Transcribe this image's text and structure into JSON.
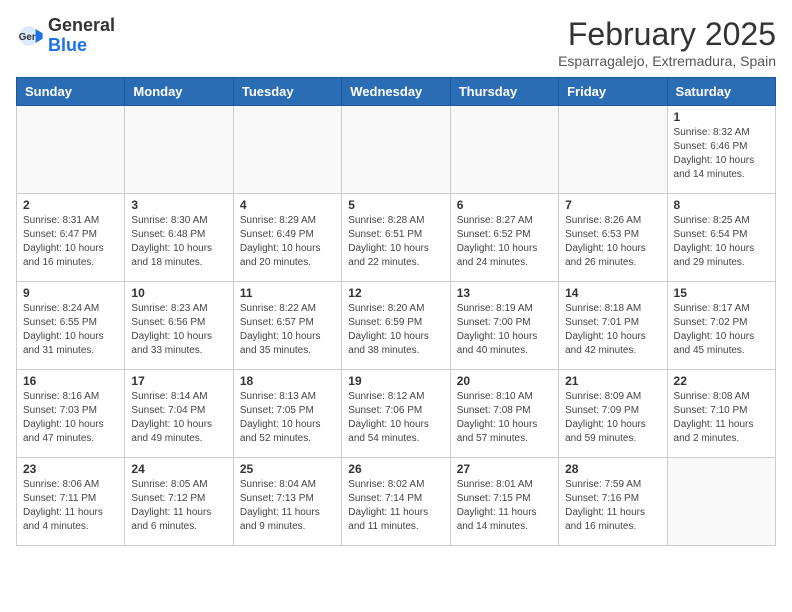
{
  "header": {
    "logo_general": "General",
    "logo_blue": "Blue",
    "month_year": "February 2025",
    "location": "Esparragalejo, Extremadura, Spain"
  },
  "weekdays": [
    "Sunday",
    "Monday",
    "Tuesday",
    "Wednesday",
    "Thursday",
    "Friday",
    "Saturday"
  ],
  "weeks": [
    [
      {
        "day": "",
        "info": ""
      },
      {
        "day": "",
        "info": ""
      },
      {
        "day": "",
        "info": ""
      },
      {
        "day": "",
        "info": ""
      },
      {
        "day": "",
        "info": ""
      },
      {
        "day": "",
        "info": ""
      },
      {
        "day": "1",
        "info": "Sunrise: 8:32 AM\nSunset: 6:46 PM\nDaylight: 10 hours and 14 minutes."
      }
    ],
    [
      {
        "day": "2",
        "info": "Sunrise: 8:31 AM\nSunset: 6:47 PM\nDaylight: 10 hours and 16 minutes."
      },
      {
        "day": "3",
        "info": "Sunrise: 8:30 AM\nSunset: 6:48 PM\nDaylight: 10 hours and 18 minutes."
      },
      {
        "day": "4",
        "info": "Sunrise: 8:29 AM\nSunset: 6:49 PM\nDaylight: 10 hours and 20 minutes."
      },
      {
        "day": "5",
        "info": "Sunrise: 8:28 AM\nSunset: 6:51 PM\nDaylight: 10 hours and 22 minutes."
      },
      {
        "day": "6",
        "info": "Sunrise: 8:27 AM\nSunset: 6:52 PM\nDaylight: 10 hours and 24 minutes."
      },
      {
        "day": "7",
        "info": "Sunrise: 8:26 AM\nSunset: 6:53 PM\nDaylight: 10 hours and 26 minutes."
      },
      {
        "day": "8",
        "info": "Sunrise: 8:25 AM\nSunset: 6:54 PM\nDaylight: 10 hours and 29 minutes."
      }
    ],
    [
      {
        "day": "9",
        "info": "Sunrise: 8:24 AM\nSunset: 6:55 PM\nDaylight: 10 hours and 31 minutes."
      },
      {
        "day": "10",
        "info": "Sunrise: 8:23 AM\nSunset: 6:56 PM\nDaylight: 10 hours and 33 minutes."
      },
      {
        "day": "11",
        "info": "Sunrise: 8:22 AM\nSunset: 6:57 PM\nDaylight: 10 hours and 35 minutes."
      },
      {
        "day": "12",
        "info": "Sunrise: 8:20 AM\nSunset: 6:59 PM\nDaylight: 10 hours and 38 minutes."
      },
      {
        "day": "13",
        "info": "Sunrise: 8:19 AM\nSunset: 7:00 PM\nDaylight: 10 hours and 40 minutes."
      },
      {
        "day": "14",
        "info": "Sunrise: 8:18 AM\nSunset: 7:01 PM\nDaylight: 10 hours and 42 minutes."
      },
      {
        "day": "15",
        "info": "Sunrise: 8:17 AM\nSunset: 7:02 PM\nDaylight: 10 hours and 45 minutes."
      }
    ],
    [
      {
        "day": "16",
        "info": "Sunrise: 8:16 AM\nSunset: 7:03 PM\nDaylight: 10 hours and 47 minutes."
      },
      {
        "day": "17",
        "info": "Sunrise: 8:14 AM\nSunset: 7:04 PM\nDaylight: 10 hours and 49 minutes."
      },
      {
        "day": "18",
        "info": "Sunrise: 8:13 AM\nSunset: 7:05 PM\nDaylight: 10 hours and 52 minutes."
      },
      {
        "day": "19",
        "info": "Sunrise: 8:12 AM\nSunset: 7:06 PM\nDaylight: 10 hours and 54 minutes."
      },
      {
        "day": "20",
        "info": "Sunrise: 8:10 AM\nSunset: 7:08 PM\nDaylight: 10 hours and 57 minutes."
      },
      {
        "day": "21",
        "info": "Sunrise: 8:09 AM\nSunset: 7:09 PM\nDaylight: 10 hours and 59 minutes."
      },
      {
        "day": "22",
        "info": "Sunrise: 8:08 AM\nSunset: 7:10 PM\nDaylight: 11 hours and 2 minutes."
      }
    ],
    [
      {
        "day": "23",
        "info": "Sunrise: 8:06 AM\nSunset: 7:11 PM\nDaylight: 11 hours and 4 minutes."
      },
      {
        "day": "24",
        "info": "Sunrise: 8:05 AM\nSunset: 7:12 PM\nDaylight: 11 hours and 6 minutes."
      },
      {
        "day": "25",
        "info": "Sunrise: 8:04 AM\nSunset: 7:13 PM\nDaylight: 11 hours and 9 minutes."
      },
      {
        "day": "26",
        "info": "Sunrise: 8:02 AM\nSunset: 7:14 PM\nDaylight: 11 hours and 11 minutes."
      },
      {
        "day": "27",
        "info": "Sunrise: 8:01 AM\nSunset: 7:15 PM\nDaylight: 11 hours and 14 minutes."
      },
      {
        "day": "28",
        "info": "Sunrise: 7:59 AM\nSunset: 7:16 PM\nDaylight: 11 hours and 16 minutes."
      },
      {
        "day": "",
        "info": ""
      }
    ]
  ]
}
